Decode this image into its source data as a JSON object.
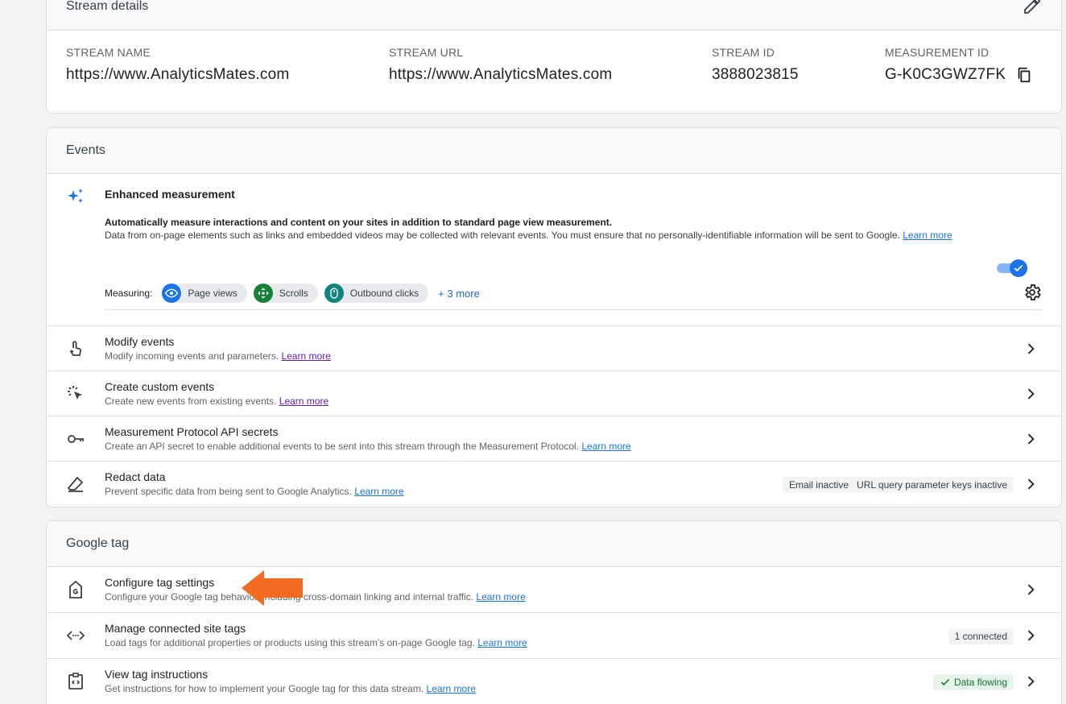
{
  "stream_details": {
    "header": "Stream details",
    "fields": [
      {
        "label": "STREAM NAME",
        "value": "https://www.AnalyticsMates.com"
      },
      {
        "label": "STREAM URL",
        "value": "https://www.AnalyticsMates.com"
      },
      {
        "label": "STREAM ID",
        "value": "3888023815"
      },
      {
        "label": "MEASUREMENT ID",
        "value": "G-K0C3GWZ7FK"
      }
    ]
  },
  "events": {
    "header": "Events",
    "enhanced": {
      "title": "Enhanced measurement",
      "desc1": "Automatically measure interactions and content on your sites in addition to standard page view measurement.",
      "desc2": "Data from on-page elements such as links and embedded videos may be collected with relevant events. You must ensure that no personally-identifiable information will be sent to Google.",
      "learn_more": "Learn more",
      "toggle_on": true,
      "measuring_label": "Measuring:",
      "chips": [
        "Page views",
        "Scrolls",
        "Outbound clicks"
      ],
      "more": "+ 3 more"
    },
    "rows": [
      {
        "title": "Modify events",
        "sub": "Modify incoming events and parameters.",
        "link": "Learn more"
      },
      {
        "title": "Create custom events",
        "sub": "Create new events from existing events.",
        "link": "Learn more"
      },
      {
        "title": "Measurement Protocol API secrets",
        "sub": "Create an API secret to enable additional events to be sent into this stream through the Measurement Protocol.",
        "link": "Learn more"
      },
      {
        "title": "Redact data",
        "sub": "Prevent specific data from being sent to Google Analytics.",
        "link": "Learn more",
        "badges": [
          "Email inactive",
          "URL query parameter keys inactive"
        ]
      }
    ]
  },
  "google_tag": {
    "header": "Google tag",
    "rows": [
      {
        "title": "Configure tag settings",
        "sub": "Configure your Google tag behavior, including cross-domain linking and internal traffic.",
        "link": "Learn more"
      },
      {
        "title": "Manage connected site tags",
        "sub": "Load tags for additional properties or products using this stream's on-page Google tag.",
        "link": "Learn more",
        "badge": "1 connected"
      },
      {
        "title": "View tag instructions",
        "sub": "Get instructions for how to implement your Google tag for this data stream.",
        "link": "Learn more",
        "badge": "Data flowing"
      }
    ]
  },
  "colors": {
    "accent": "#1a73e8",
    "annotation_arrow": "#f26b21",
    "green": "#137333"
  }
}
